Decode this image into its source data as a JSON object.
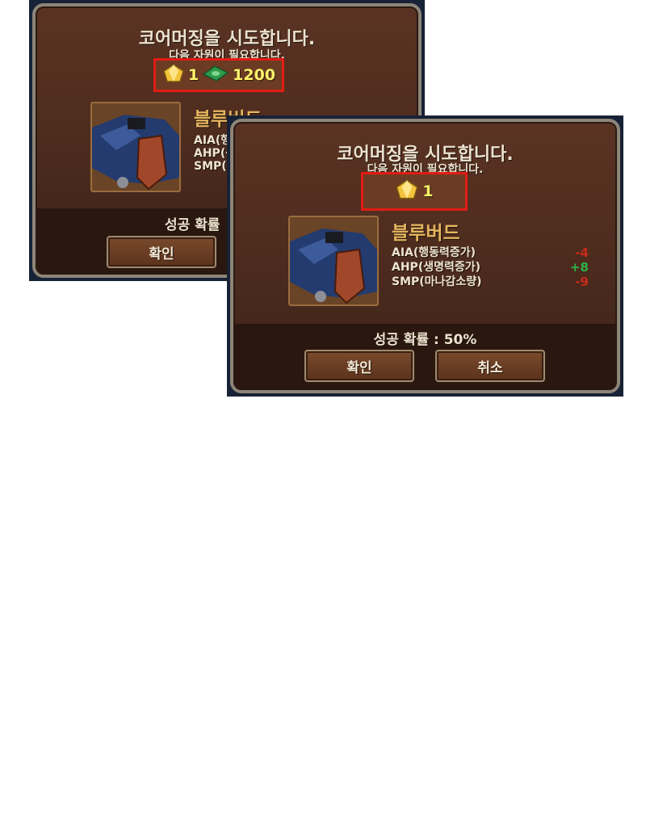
{
  "back_dialog": {
    "title": "코어머징을 시도합니다.",
    "subtitle": "다음 자원이 필요합니다.",
    "cost": {
      "gem_count": "1",
      "cash_amount": "1200"
    },
    "unit_name": "블루버드",
    "stats": [
      "AIA(행",
      "AHP(상",
      "SMP(I"
    ],
    "success_rate": "성공 확률",
    "confirm_label": "확인"
  },
  "front_dialog": {
    "title": "코어머징을 시도합니다.",
    "subtitle": "다음 자원이 필요합니다.",
    "cost": {
      "gem_count": "1"
    },
    "unit_name": "블루버드",
    "stats": [
      {
        "label": "AIA(행동력증가)",
        "value": "-4",
        "color": "#c92a1a"
      },
      {
        "label": "AHP(생명력증가)",
        "value": "+8",
        "color": "#2fb24a"
      },
      {
        "label": "SMP(마나감소량)",
        "value": "-9",
        "color": "#c92a1a"
      }
    ],
    "success_rate": "성공 확률 : 50%",
    "confirm_label": "확인",
    "cancel_label": "취소"
  },
  "icons": {
    "gem": "gold-gem-icon",
    "cash": "green-cash-icon",
    "portrait": "bluebird-robot-portrait"
  },
  "colors": {
    "highlight_border": "#e21c14",
    "cost_text": "#fff36a",
    "unit_name": "#e4b55e"
  }
}
